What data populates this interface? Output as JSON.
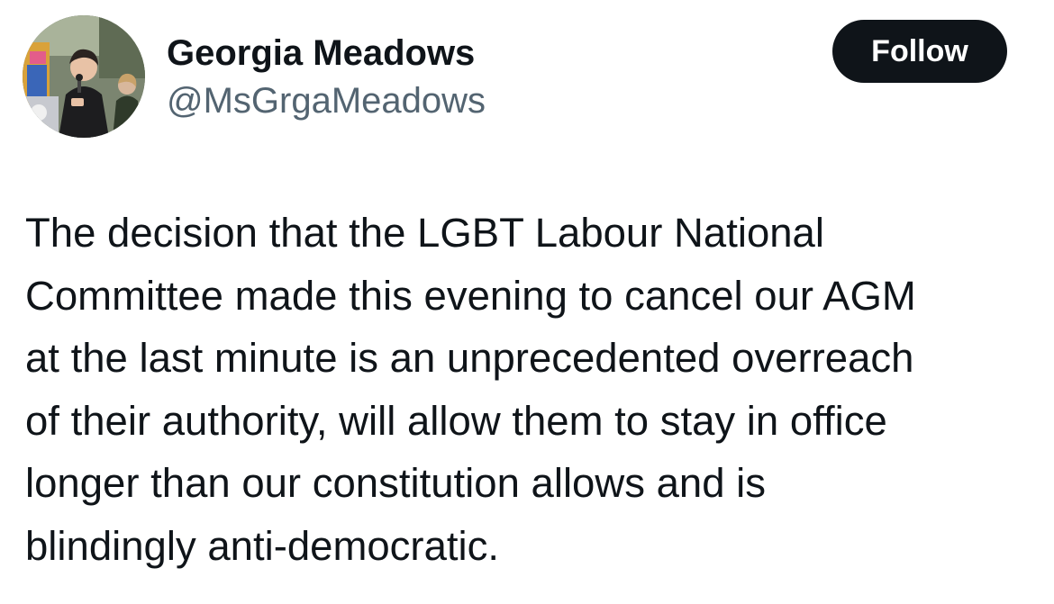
{
  "author": {
    "display_name": "Georgia Meadows",
    "handle": "@MsGrgaMeadows",
    "avatar_icon": "profile-photo-person-with-microphone"
  },
  "follow_button": {
    "label": "Follow",
    "background": "#0f1419",
    "text_color": "#ffffff"
  },
  "tweet": {
    "lines": [
      "The decision that the LGBT Labour National",
      "Committee made this evening to cancel our AGM",
      "at the last minute is an unprecedented overreach",
      "of their authority, will allow them to stay in office",
      "longer than our constitution allows and is",
      "blindingly anti-democratic."
    ]
  },
  "colors": {
    "text_primary": "#0f1419",
    "text_secondary": "#536471",
    "background": "#ffffff"
  }
}
